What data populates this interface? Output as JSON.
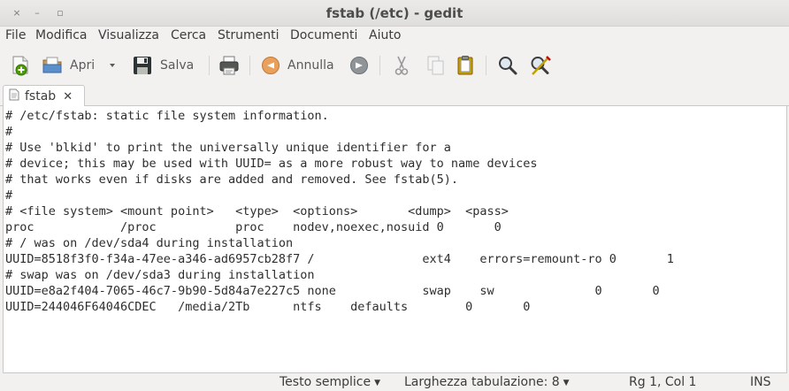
{
  "window": {
    "title": "fstab (/etc) - gedit",
    "controls": [
      "×",
      "–",
      "▫"
    ]
  },
  "menu": [
    "File",
    "Modifica",
    "Visualizza",
    "Cerca",
    "Strumenti",
    "Documenti",
    "Aiuto"
  ],
  "toolbar": {
    "open_label": "Apri",
    "save_label": "Salva",
    "undo_label": "Annulla",
    "icons": [
      "new-document-icon",
      "open-folder-icon",
      "dropdown-arrow-icon",
      "save-icon",
      "print-icon",
      "undo-icon",
      "redo-icon",
      "cut-icon",
      "copy-icon",
      "paste-icon",
      "find-icon",
      "find-replace-icon"
    ]
  },
  "tab": {
    "label": "fstab",
    "close": "✕"
  },
  "editor": {
    "lines": [
      "# /etc/fstab: static file system information.",
      "#",
      "# Use 'blkid' to print the universally unique identifier for a",
      "# device; this may be used with UUID= as a more robust way to name devices",
      "# that works even if disks are added and removed. See fstab(5).",
      "#",
      "# <file system> <mount point>   <type>  <options>       <dump>  <pass>",
      "proc            /proc           proc    nodev,noexec,nosuid 0       0",
      "# / was on /dev/sda4 during installation",
      "UUID=8518f3f0-f34a-47ee-a346-ad6957cb28f7 /               ext4    errors=remount-ro 0       1",
      "# swap was on /dev/sda3 during installation",
      "UUID=e8a2f404-7065-46c7-9b90-5d84a7e227c5 none            swap    sw              0       0",
      "UUID=244046F64046CDEC   /media/2Tb      ntfs    defaults        0       0"
    ]
  },
  "status": {
    "language": "Testo semplice",
    "tab_width": "Larghezza tabulazione:  8",
    "position": "Rg 1, Col 1",
    "mode": "INS"
  }
}
